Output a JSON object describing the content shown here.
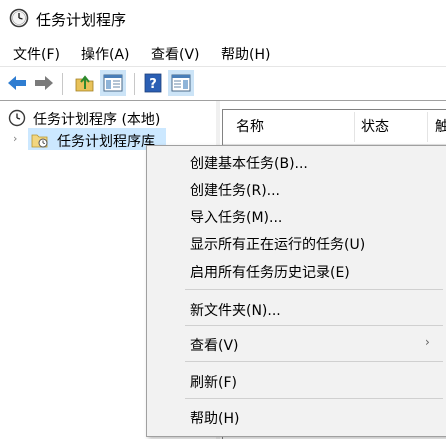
{
  "window": {
    "title": "任务计划程序"
  },
  "menubar": {
    "items": [
      "文件(F)",
      "操作(A)",
      "查看(V)",
      "帮助(H)"
    ]
  },
  "toolbar": {
    "buttons": [
      "back-arrow-icon",
      "forward-arrow-icon",
      "up-folder-icon",
      "show-hide-console-tree-icon",
      "help-icon",
      "show-hide-action-pane-icon"
    ]
  },
  "tree": {
    "root_label": "任务计划程序 (本地)",
    "library_label": "任务计划程序库",
    "expander": "›"
  },
  "list": {
    "columns": [
      "名称",
      "状态",
      "触"
    ]
  },
  "context_menu": {
    "items": [
      "创建基本任务(B)...",
      "创建任务(R)...",
      "导入任务(M)...",
      "显示所有正在运行的任务(U)",
      "启用所有任务历史记录(E)",
      "新文件夹(N)...",
      "查看(V)",
      "刷新(F)",
      "帮助(H)"
    ],
    "submenu_arrow": "›"
  },
  "colors": {
    "selection": "#cce8ff",
    "menu_bg": "#f2f2f2",
    "toolbar_arrow": "#2f7dd1"
  }
}
